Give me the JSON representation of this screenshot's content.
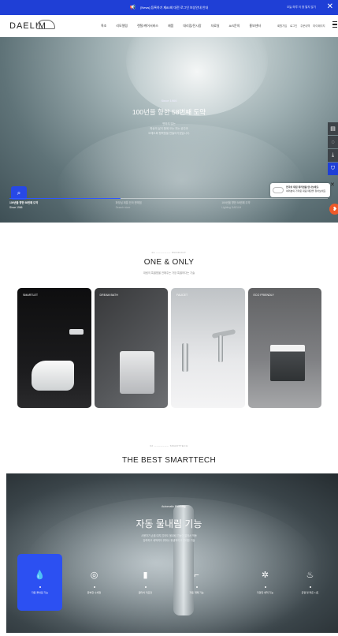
{
  "topbar": {
    "notice": "[News] 등록하기 제80회 대전 로그인 보상안내 안내",
    "right": "오늘 하루 이 창 열지 않기",
    "close": "✕"
  },
  "header": {
    "logo": "DAELIM",
    "nav": [
      "욕조",
      "리모델링",
      "렌탈/케어서비스",
      "제품",
      "대리점/전시장",
      "자료실",
      "A/S문의",
      "홍보센터"
    ],
    "util": [
      "회원가입",
      "로그인",
      "주문내역",
      "마이페이지"
    ]
  },
  "hero": {
    "since": "Since 1966",
    "title": "100년을 향한 58번째 도약",
    "sub_line1": "변하지 않는",
    "sub_line2": "최상의 삶이 함께 오는 지는 공간과",
    "sub_line3": "오래도록 행복함을 만들어가겠습니다.",
    "progress": 0.35,
    "slides": [
      {
        "title": "100년을 향한 58번째 도약",
        "sub": "Since 1966"
      },
      {
        "title": "화장실 제품 전국 판매점",
        "sub": "Search store"
      },
      {
        "title": "100년을 향한 58번째 도약",
        "sub": "Lighting DAELIM"
      }
    ]
  },
  "toast": {
    "line1": "전국의 대림 대리점을 만나보세요.",
    "line2": "여러분의 가까운 대림 매장을 찾아보세요.",
    "close": "✕"
  },
  "sidebar_icons": [
    "store-icon",
    "chat-icon",
    "download-icon",
    "cart-icon"
  ],
  "one_only": {
    "kicker": "01 ─────── PRODUCT",
    "title": "ONE & ONLY",
    "sub": "대림의 특별함을 전해주는 가장 특별하다는 기술",
    "cards": [
      {
        "label": "SMARTLET"
      },
      {
        "label": "DREAM BATH"
      },
      {
        "label": "FAUCET"
      },
      {
        "label": "ECO FRIENDLY"
      }
    ]
  },
  "smarttech": {
    "kicker": "02 ─────── SMARTTECH",
    "title": "THE BEST SMARTTECH",
    "auto_label": "Automatic Flushing",
    "big_title": "자동 물내림 기능",
    "sub_line1": "사용자가 손을 대지 않아도 물내림 기능이 알아서 작동",
    "sub_line2": "강력하고 세척력이 뛰어나 위생적이고 편리한 기술",
    "features": [
      {
        "icon": "💧",
        "label": "자동 물내림 기능",
        "active": true
      },
      {
        "icon": "◎",
        "label": "완벽한 수세정",
        "active": false
      },
      {
        "icon": "▮",
        "label": "원터치 리모컨",
        "active": false
      },
      {
        "icon": "⌐",
        "label": "자동 개폐 기능",
        "active": false
      },
      {
        "icon": "✲",
        "label": "다양한 세척 기능",
        "active": false
      },
      {
        "icon": "♨",
        "label": "온열 및 좌온 시트",
        "active": false
      }
    ]
  }
}
